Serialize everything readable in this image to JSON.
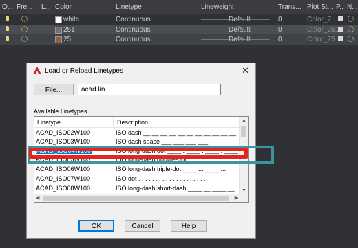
{
  "layer_manager": {
    "columns": [
      "O...",
      "Fre...",
      "L...",
      "Color",
      "Linetype",
      "Lineweight",
      "Trans...",
      "Plot St...",
      "P...",
      "N..."
    ],
    "rows": [
      {
        "color_name": "white",
        "color_hex": "#ffffff",
        "linetype": "Continuous",
        "lineweight": "Default",
        "transparency": "0",
        "plot_style": "Color_7"
      },
      {
        "color_name": "251",
        "color_hex": "#707070",
        "linetype": "Continuous",
        "lineweight": "Default",
        "transparency": "0",
        "plot_style": "Color_251"
      },
      {
        "color_name": "25",
        "color_hex": "#9a5a3a",
        "linetype": "Continuous",
        "lineweight": "Default",
        "transparency": "0",
        "plot_style": "Color_25"
      }
    ]
  },
  "dialog": {
    "title": "Load or Reload Linetypes",
    "close_glyph": "✕",
    "file_button": "File...",
    "file_value": "acad.lin",
    "available_label": "Available Linetypes",
    "col_linetype": "Linetype",
    "col_description": "Description",
    "linetypes": [
      {
        "name": "ACAD_ISO02W100",
        "desc": "ISO dash __ __ __ __ __ __ __ __ __ __ __"
      },
      {
        "name": "ACAD_ISO03W100",
        "desc": "ISO dash space ___    ___    ___    ___"
      },
      {
        "name": "ACAD_ISO04W100",
        "desc": "ISO long-dash dot ____ . ____ . ____ . ____ . _"
      },
      {
        "name": "ACAD_ISO05W100",
        "desc": "ISO long-dash double-dot ____ .. ____ .. ____"
      },
      {
        "name": "ACAD_ISO06W100",
        "desc": "ISO long-dash triple-dot ____ ... ____ ..."
      },
      {
        "name": "ACAD_ISO07W100",
        "desc": "ISO dot . . . . . . . . . . . . . . . . . . . ."
      },
      {
        "name": "ACAD_ISO08W100",
        "desc": "ISO long-dash short-dash ____ __ ____ __"
      }
    ],
    "selected_index": 2,
    "ok_label": "OK",
    "cancel_label": "Cancel",
    "help_label": "Help"
  },
  "colors": {
    "highlight_red": "#e4251b",
    "highlight_teal": "#3a94a6",
    "selection_blue": "#0078d7",
    "bulb": "#e9d47a"
  }
}
